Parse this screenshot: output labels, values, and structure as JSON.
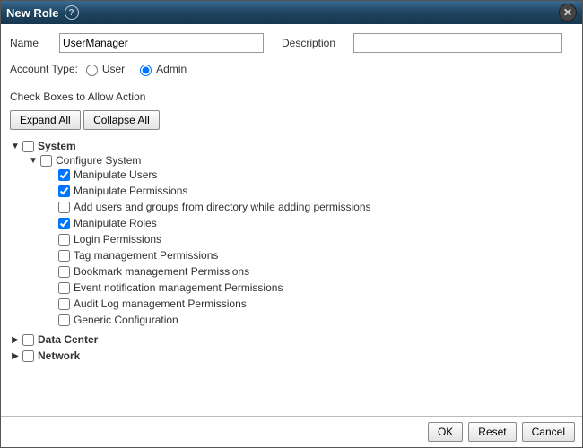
{
  "dialog": {
    "title": "New Role",
    "help_icon": "?",
    "close_icon": "✕"
  },
  "fields": {
    "name_label": "Name",
    "name_value": "UserManager",
    "desc_label": "Description",
    "desc_value": ""
  },
  "account_type": {
    "label": "Account Type:",
    "user_label": "User",
    "admin_label": "Admin",
    "selected": "Admin"
  },
  "permissions": {
    "header": "Check Boxes to Allow Action",
    "expand_all": "Expand All",
    "collapse_all": "Collapse All"
  },
  "tree": {
    "system": {
      "label": "System",
      "configure_system": {
        "label": "Configure System",
        "items": [
          {
            "label": "Manipulate Users",
            "checked": true
          },
          {
            "label": "Manipulate Permissions",
            "checked": true
          },
          {
            "label": "Add users and groups from directory while adding permissions",
            "checked": false
          },
          {
            "label": "Manipulate Roles",
            "checked": true
          },
          {
            "label": "Login Permissions",
            "checked": false
          },
          {
            "label": "Tag management Permissions",
            "checked": false
          },
          {
            "label": "Bookmark management Permissions",
            "checked": false
          },
          {
            "label": "Event notification management Permissions",
            "checked": false
          },
          {
            "label": "Audit Log management Permissions",
            "checked": false
          },
          {
            "label": "Generic Configuration",
            "checked": false
          }
        ]
      }
    },
    "data_center": {
      "label": "Data Center"
    },
    "network": {
      "label": "Network"
    }
  },
  "footer": {
    "ok": "OK",
    "reset": "Reset",
    "cancel": "Cancel"
  }
}
